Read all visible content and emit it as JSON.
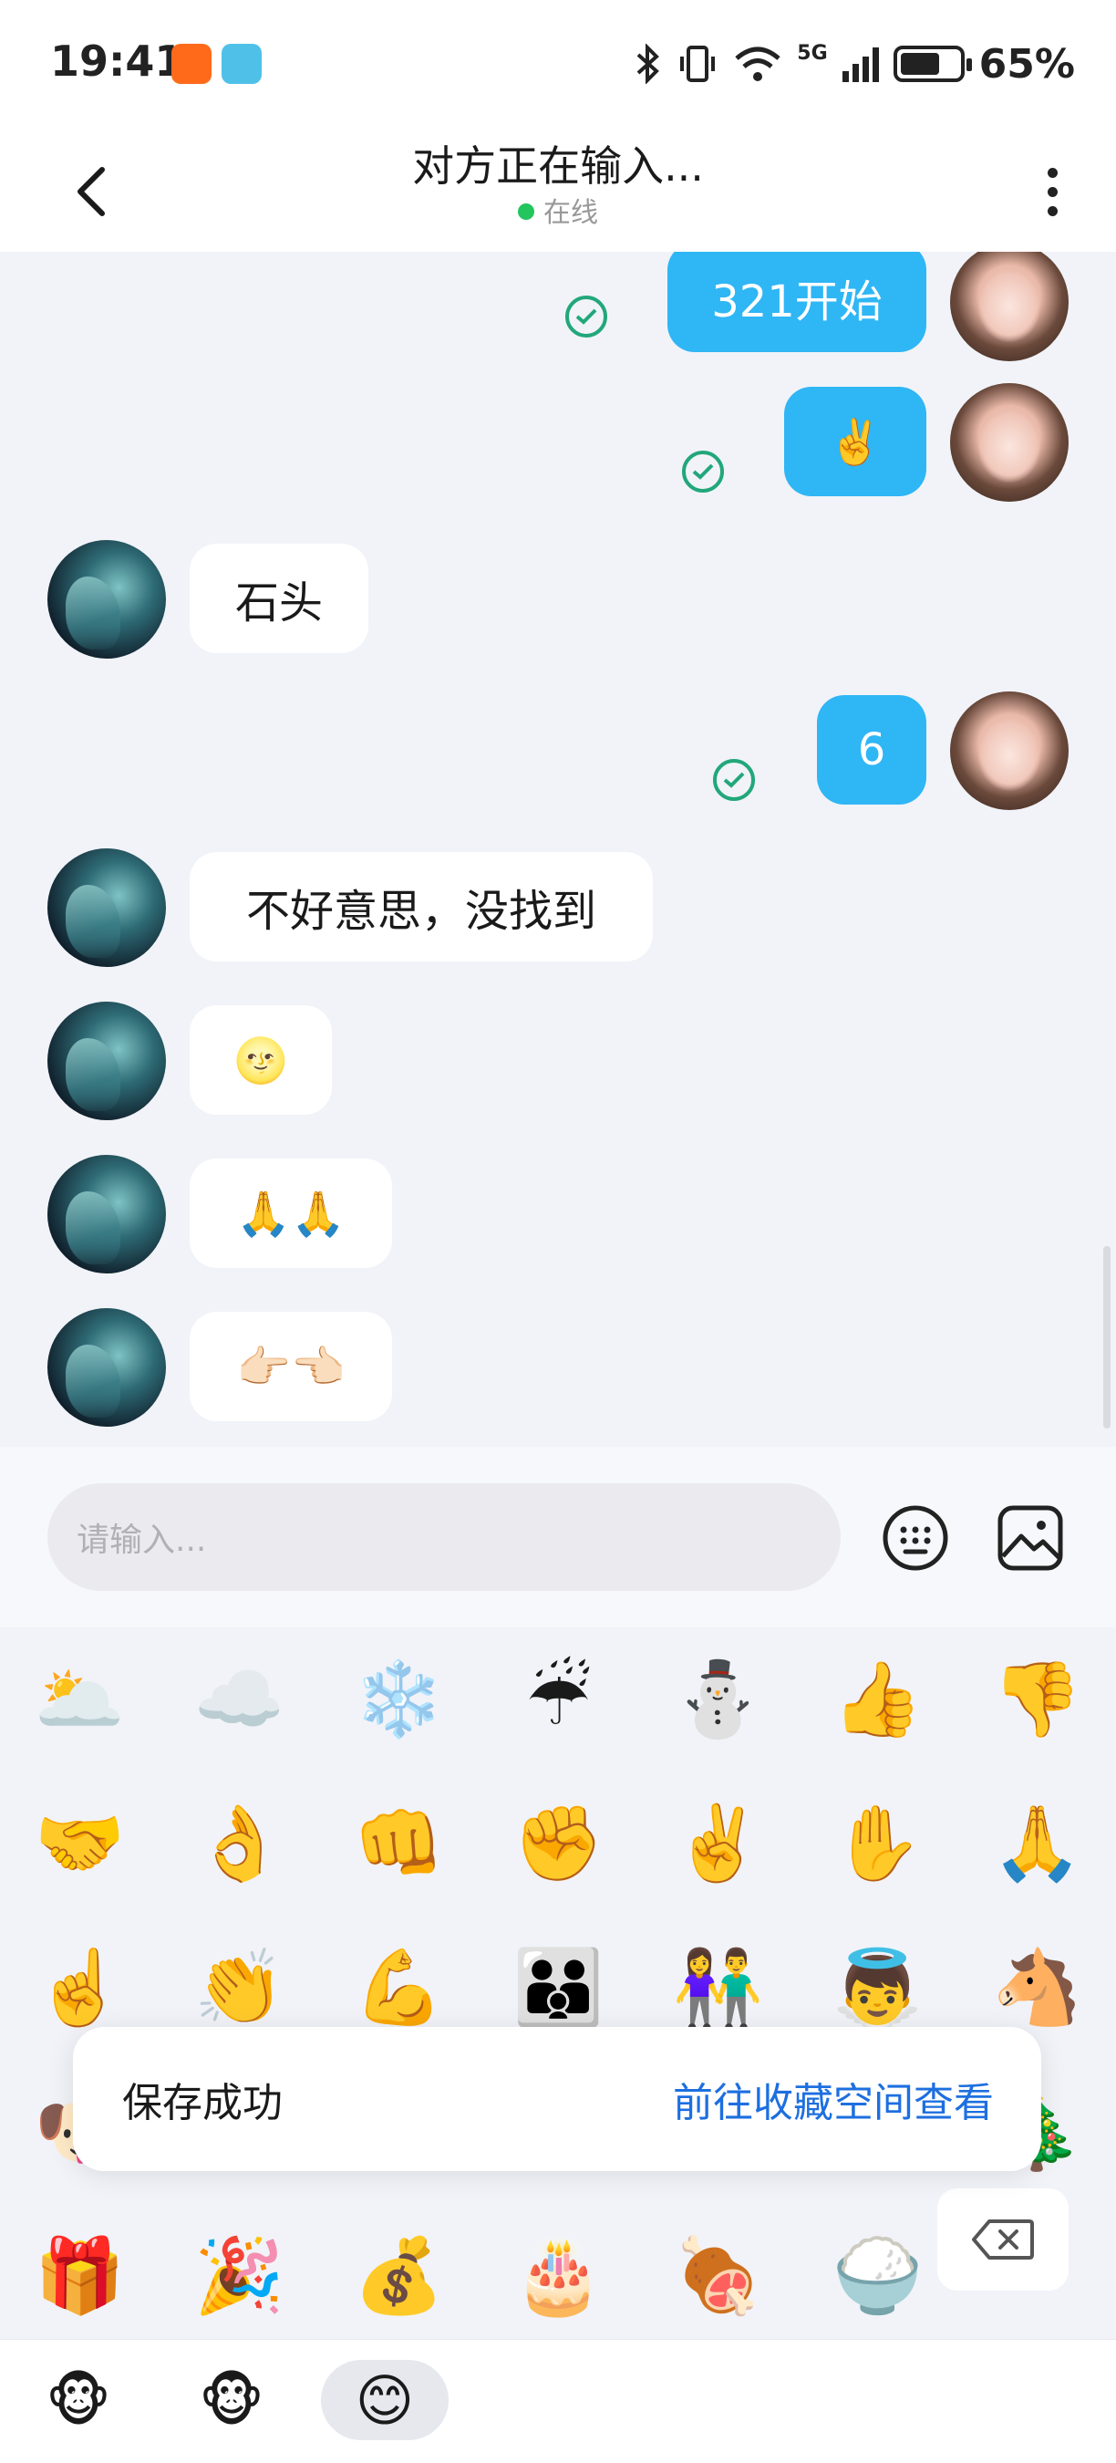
{
  "status_bar": {
    "time": "19:41",
    "network": "5G",
    "battery": "65%"
  },
  "header": {
    "title": "对方正在输入...",
    "status": "在线"
  },
  "messages": [
    {
      "sender": "me",
      "text": "321开始",
      "read": true
    },
    {
      "sender": "me",
      "text": "✌️",
      "read": true
    },
    {
      "sender": "other",
      "text": "石头"
    },
    {
      "sender": "me",
      "text": "6",
      "read": true
    },
    {
      "sender": "other",
      "text": "不好意思，没找到"
    },
    {
      "sender": "other",
      "text": "🌝"
    },
    {
      "sender": "other",
      "text": "🙏🙏"
    },
    {
      "sender": "other",
      "text": "👉🏻👈🏻"
    }
  ],
  "input": {
    "placeholder": "请输入..."
  },
  "emojis": [
    "🌥️",
    "☁️",
    "❄️",
    "☔",
    "⛄",
    "👍",
    "👎",
    "🤝",
    "👌",
    "👊",
    "✊",
    "✌️",
    "✋",
    "🙏",
    "☝️",
    "👏",
    "💪",
    "👪",
    "👫",
    "👼",
    "🐴",
    "🐶",
    "",
    "",
    "",
    "",
    "",
    "🎄",
    "🎁",
    "🎉",
    "💰",
    "🎂",
    "🍖",
    "🍚",
    ""
  ],
  "toast": {
    "text": "保存成功",
    "action": "前往收藏空间查看"
  },
  "bottom_tabs": [
    "🐵",
    "🐵",
    "😊"
  ],
  "colors": {
    "outgoing_bubble": "#2fb6f5",
    "incoming_bubble": "#ffffff",
    "link": "#1d6fe0",
    "online": "#22c55e",
    "read_check": "#22a77a"
  }
}
